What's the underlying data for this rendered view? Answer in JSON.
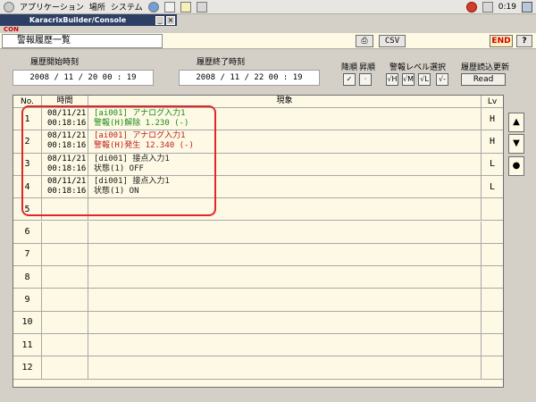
{
  "panel": {
    "menus": [
      "アプリケーション",
      "場所",
      "システム"
    ],
    "clock": "0:19"
  },
  "console": {
    "title": "KaracrixBuilder/Console",
    "min": "_",
    "close": "×",
    "con_label": "CON"
  },
  "screen": {
    "title": "警報履歴一覧",
    "csv_label": "CSV",
    "end_label": "END",
    "help_label": "?",
    "print_icon": "⎙"
  },
  "date_start": {
    "label": "履歴開始時刻",
    "value": "2008 / 11 / 20    00 : 19"
  },
  "date_end": {
    "label": "履歴終了時刻",
    "value": "2008 / 11 / 22    00 : 19"
  },
  "options": {
    "desc_label": "降順",
    "asc_label": "昇順",
    "level_label": "警報レベル選択",
    "reload_label": "履歴読込更新",
    "read_label": "Read",
    "desc_check": "✓",
    "asc_check": "·",
    "lv_h": "√H",
    "lv_m": "√M",
    "lv_l": "√L",
    "lv_other": "√-"
  },
  "table": {
    "headers": {
      "no": "No.",
      "time": "時間",
      "event": "現象",
      "lv": "Lv"
    },
    "rows": [
      {
        "no": "1",
        "date": "08/11/21",
        "time": "00:18:16",
        "line1": "[ai001] アナログ入力1",
        "line2": "警報(H)解除    1.230 (-)",
        "color": "green",
        "lv": "H"
      },
      {
        "no": "2",
        "date": "08/11/21",
        "time": "00:18:16",
        "line1": "[ai001] アナログ入力1",
        "line2": "警報(H)発生   12.340 (-)",
        "color": "red",
        "lv": "H"
      },
      {
        "no": "3",
        "date": "08/11/21",
        "time": "00:18:16",
        "line1": "[di001] 接点入力1",
        "line2": "状態(1) OFF",
        "color": "dark",
        "lv": "L"
      },
      {
        "no": "4",
        "date": "08/11/21",
        "time": "00:18:16",
        "line1": "[di001] 接点入力1",
        "line2": "状態(1) ON",
        "color": "dark",
        "lv": "L"
      },
      {
        "no": "5",
        "date": "",
        "time": "",
        "line1": "",
        "line2": "",
        "color": "dark",
        "lv": ""
      },
      {
        "no": "6",
        "date": "",
        "time": "",
        "line1": "",
        "line2": "",
        "color": "dark",
        "lv": ""
      },
      {
        "no": "7",
        "date": "",
        "time": "",
        "line1": "",
        "line2": "",
        "color": "dark",
        "lv": ""
      },
      {
        "no": "8",
        "date": "",
        "time": "",
        "line1": "",
        "line2": "",
        "color": "dark",
        "lv": ""
      },
      {
        "no": "9",
        "date": "",
        "time": "",
        "line1": "",
        "line2": "",
        "color": "dark",
        "lv": ""
      },
      {
        "no": "10",
        "date": "",
        "time": "",
        "line1": "",
        "line2": "",
        "color": "dark",
        "lv": ""
      },
      {
        "no": "11",
        "date": "",
        "time": "",
        "line1": "",
        "line2": "",
        "color": "dark",
        "lv": ""
      },
      {
        "no": "12",
        "date": "",
        "time": "",
        "line1": "",
        "line2": "",
        "color": "dark",
        "lv": ""
      }
    ]
  },
  "scroll": {
    "up": "▲",
    "down": "▼",
    "dot": "●"
  }
}
